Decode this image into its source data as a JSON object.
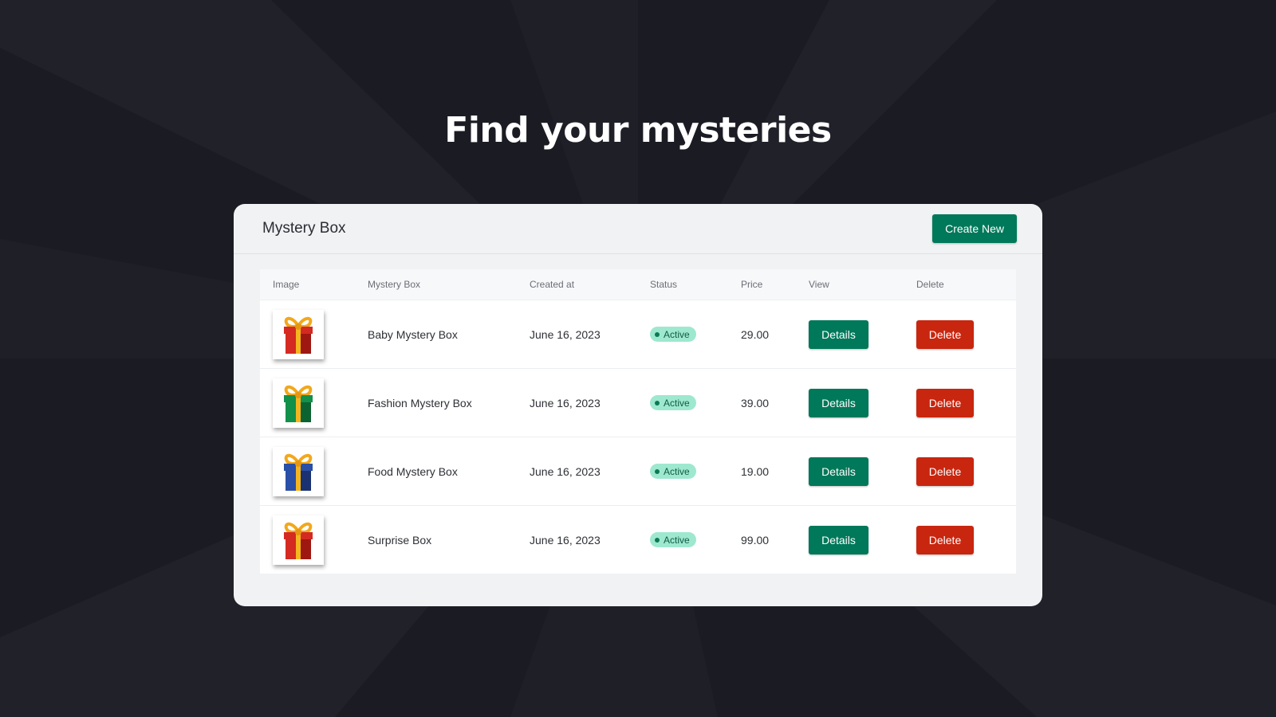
{
  "hero": {
    "title": "Find your mysteries"
  },
  "card": {
    "title": "Mystery Box",
    "create_label": "Create New"
  },
  "table": {
    "columns": [
      "Image",
      "Mystery Box",
      "Created at",
      "Status",
      "Price",
      "View",
      "Delete"
    ],
    "rows": [
      {
        "name": "Baby Mystery Box",
        "created": "June 16, 2023",
        "status": "Active",
        "price": "29.00",
        "view_label": "Details",
        "delete_label": "Delete",
        "gift_color": "red"
      },
      {
        "name": "Fashion Mystery Box",
        "created": "June 16, 2023",
        "status": "Active",
        "price": "39.00",
        "view_label": "Details",
        "delete_label": "Delete",
        "gift_color": "green"
      },
      {
        "name": "Food Mystery Box",
        "created": "June 16, 2023",
        "status": "Active",
        "price": "19.00",
        "view_label": "Details",
        "delete_label": "Delete",
        "gift_color": "blue"
      },
      {
        "name": "Surprise Box",
        "created": "June 16, 2023",
        "status": "Active",
        "price": "99.00",
        "view_label": "Details",
        "delete_label": "Delete",
        "gift_color": "red"
      }
    ]
  },
  "colors": {
    "background": "#1b1c23",
    "card": "#f1f2f4",
    "primary": "#00785a",
    "danger": "#c8260f",
    "status_active": "#9ee8cf"
  }
}
